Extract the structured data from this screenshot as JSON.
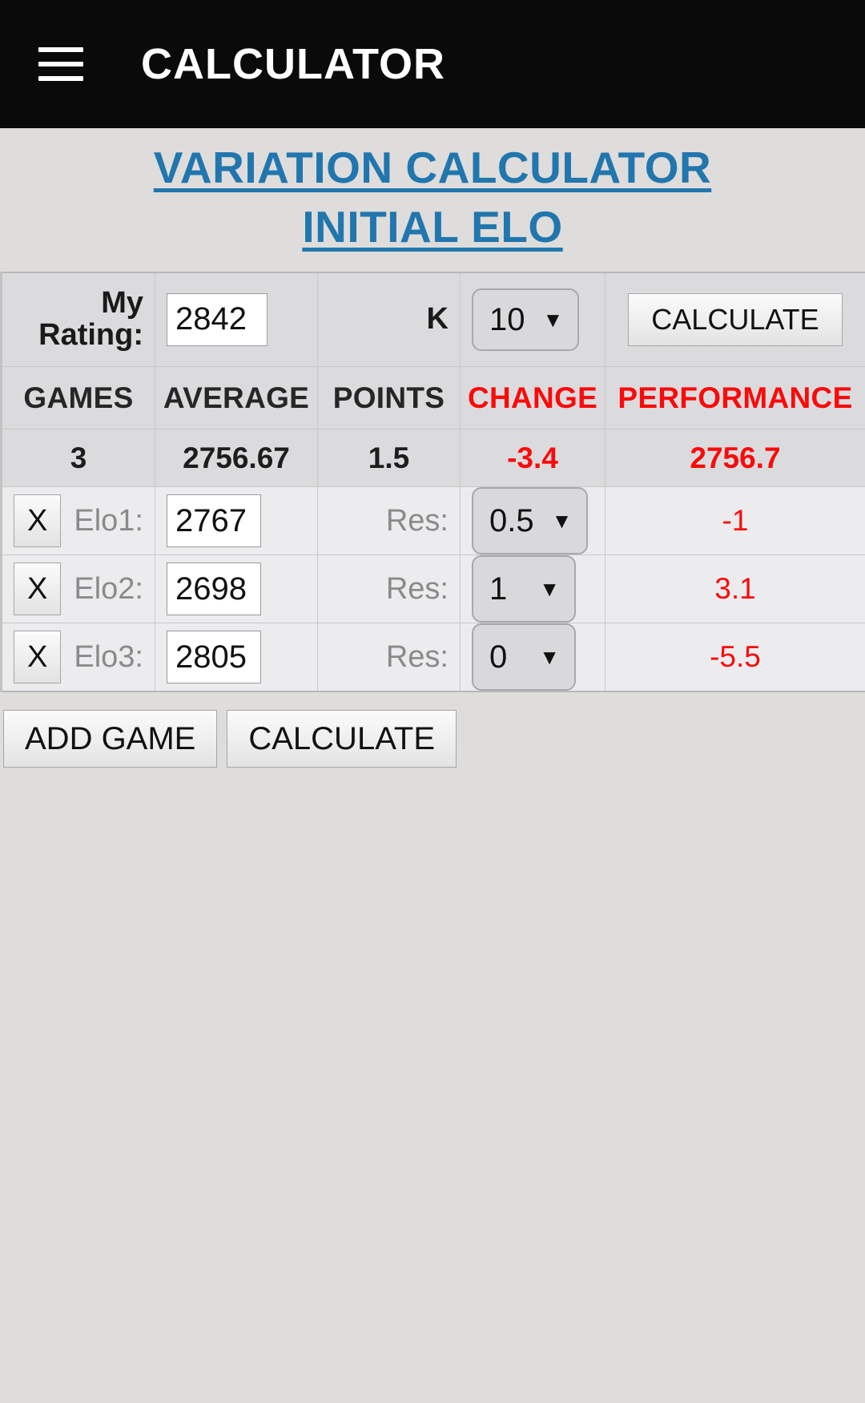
{
  "appbar": {
    "menu_icon": "hamburger-menu-icon",
    "title": "CALCULATOR"
  },
  "heading": {
    "line1": "VARIATION CALCULATOR",
    "line2": "INITIAL ELO",
    "color": "#2176ae"
  },
  "summary": {
    "my_rating_label": "My Rating:",
    "my_rating_value": "2842",
    "k_label": "K",
    "k_value": "10",
    "calculate_label": "CALCULATE",
    "caret_icon": "chevron-down-icon"
  },
  "columns": {
    "games": "GAMES",
    "average": "AVERAGE",
    "points": "POINTS",
    "change": "CHANGE",
    "performance": "PERFORMANCE",
    "change_color": "#fa0a0a",
    "performance_color": "#fa0a0a"
  },
  "totals": {
    "games": "3",
    "average": "2756.67",
    "points": "1.5",
    "change": "-3.4",
    "performance": "2756.7"
  },
  "games": [
    {
      "delete_label": "X",
      "elo_label": "Elo1:",
      "elo_value": "2767",
      "res_label": "Res:",
      "res_value": "0.5",
      "change": "-1"
    },
    {
      "delete_label": "X",
      "elo_label": "Elo2:",
      "elo_value": "2698",
      "res_value": "1",
      "res_label": "Res:",
      "change": "3.1"
    },
    {
      "delete_label": "X",
      "elo_label": "Elo3:",
      "elo_value": "2805",
      "res_label": "Res:",
      "res_value": "0",
      "change": "-5.5"
    }
  ],
  "actions": {
    "add_game": "ADD GAME",
    "calculate": "CALCULATE"
  }
}
